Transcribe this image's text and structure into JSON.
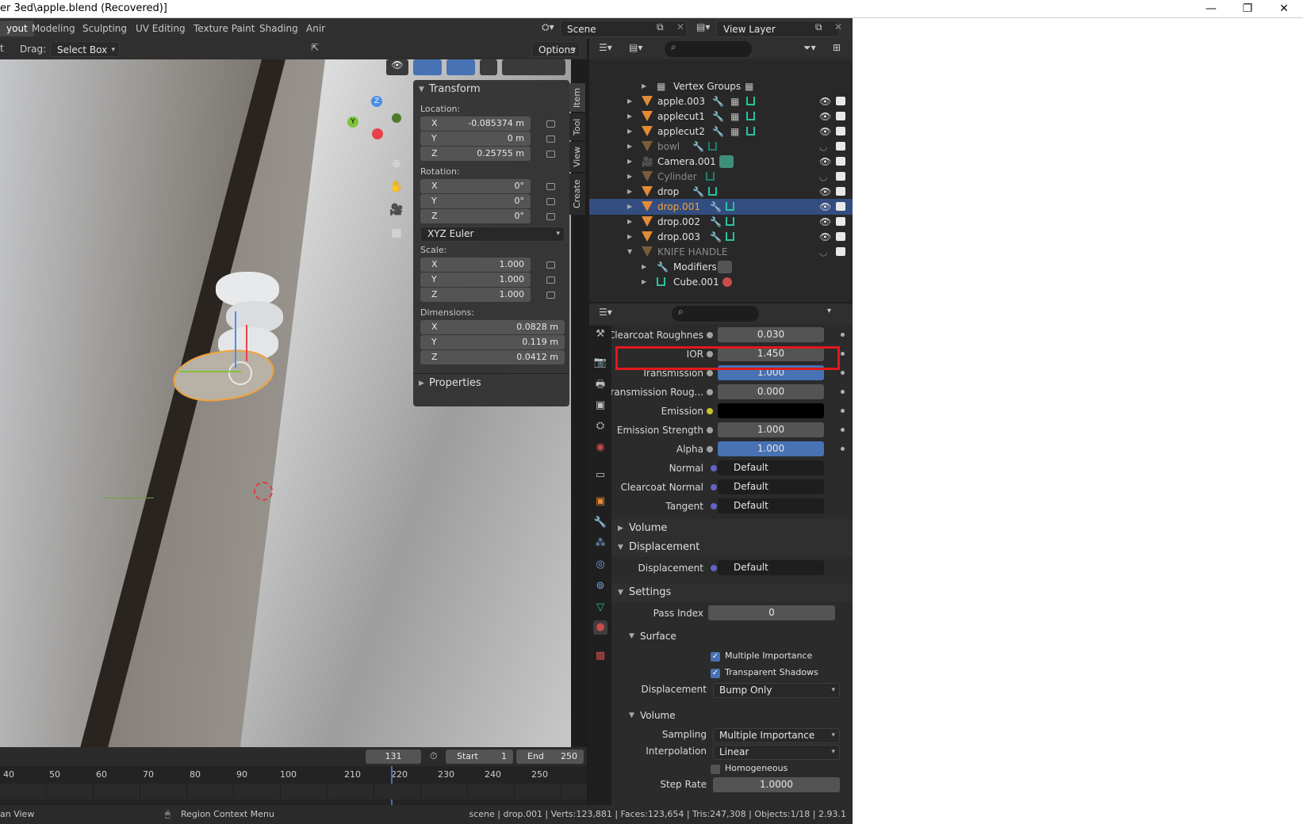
{
  "window": {
    "title": "er 3ed\\apple.blend (Recovered)]",
    "controls": [
      "—",
      "❐",
      "✕"
    ]
  },
  "workspaces": [
    "yout",
    "Modeling",
    "Sculpting",
    "UV Editing",
    "Texture Paint",
    "Shading",
    "Anir"
  ],
  "scene": {
    "label": "Scene",
    "view_layer": "View Layer"
  },
  "viewport_header": {
    "tool_left": "t",
    "drag_label": "Drag:",
    "drag_value": "Select Box",
    "options": "Options"
  },
  "npanel": {
    "title": "Transform",
    "location_label": "Location:",
    "loc": [
      {
        "axis": "X",
        "value": "-0.085374 m"
      },
      {
        "axis": "Y",
        "value": "0 m"
      },
      {
        "axis": "Z",
        "value": "0.25755 m"
      }
    ],
    "rotation_label": "Rotation:",
    "rot": [
      {
        "axis": "X",
        "value": "0°"
      },
      {
        "axis": "Y",
        "value": "0°"
      },
      {
        "axis": "Z",
        "value": "0°"
      }
    ],
    "rotation_mode": "XYZ Euler",
    "scale_label": "Scale:",
    "scale": [
      {
        "axis": "X",
        "value": "1.000"
      },
      {
        "axis": "Y",
        "value": "1.000"
      },
      {
        "axis": "Z",
        "value": "1.000"
      }
    ],
    "dimensions_label": "Dimensions:",
    "dim": [
      {
        "axis": "X",
        "value": "0.0828 m"
      },
      {
        "axis": "Y",
        "value": "0.119 m"
      },
      {
        "axis": "Z",
        "value": "0.0412 m"
      }
    ],
    "properties": "Properties",
    "tabs": [
      "Item",
      "Tool",
      "View",
      "Create"
    ]
  },
  "outliner": {
    "rows": [
      {
        "name": "Vertex Groups"
      },
      {
        "name": "apple.003"
      },
      {
        "name": "applecut1"
      },
      {
        "name": "applecut2"
      },
      {
        "name": "bowl"
      },
      {
        "name": "Camera.001"
      },
      {
        "name": "Cylinder"
      },
      {
        "name": "drop"
      },
      {
        "name": "drop.001"
      },
      {
        "name": "drop.002"
      },
      {
        "name": "drop.003"
      },
      {
        "name": "KNIFE HANDLE"
      },
      {
        "name": "Modifiers"
      },
      {
        "name": "Cube.001"
      }
    ]
  },
  "properties": {
    "rows": [
      {
        "label": "Clearcoat Roughnes",
        "value": "0.030"
      },
      {
        "label": "IOR",
        "value": "1.450"
      },
      {
        "label": "Transmission",
        "value": "1.000"
      },
      {
        "label": "Transmission Roug...",
        "value": "0.000"
      },
      {
        "label": "Emission",
        "value": ""
      },
      {
        "label": "Emission Strength",
        "value": "1.000"
      },
      {
        "label": "Alpha",
        "value": "1.000"
      },
      {
        "label": "Normal",
        "value": "Default"
      },
      {
        "label": "Clearcoat Normal",
        "value": "Default"
      },
      {
        "label": "Tangent",
        "value": "Default"
      }
    ],
    "volume_section": "Volume",
    "displacement_section": "Displacement",
    "displacement_label": "Displacement",
    "displacement_value": "Default",
    "settings_section": "Settings",
    "pass_index_label": "Pass Index",
    "pass_index": "0",
    "surface_section": "Surface",
    "multiple_importance": "Multiple Importance",
    "transparent_shadows": "Transparent Shadows",
    "surf_displacement_label": "Displacement",
    "surf_displacement_value": "Bump Only",
    "volume_sub": "Volume",
    "sampling_label": "Sampling",
    "sampling_value": "Multiple Importance",
    "interpolation_label": "Interpolation",
    "interpolation_value": "Linear",
    "homogeneous": "Homogeneous",
    "step_rate_label": "Step Rate",
    "step_rate": "1.0000"
  },
  "timeline": {
    "frame": "131",
    "start_label": "Start",
    "start": "1",
    "end_label": "End",
    "end": "250",
    "ticks": [
      "40",
      "50",
      "60",
      "70",
      "80",
      "90",
      "100",
      "210",
      "220",
      "230",
      "240",
      "250"
    ]
  },
  "status": {
    "left": "an View",
    "mid": "Region Context Menu",
    "right": "scene | drop.001 | Verts:123,881 | Faces:123,654 | Tris:247,308 | Objects:1/18 | 2.93.1"
  }
}
